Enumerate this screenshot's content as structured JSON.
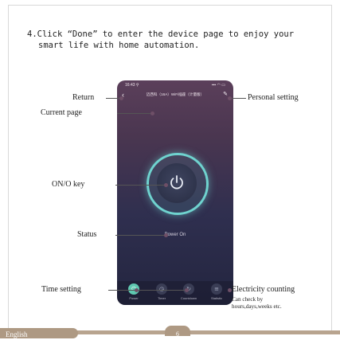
{
  "step": {
    "number": "4.",
    "text_line1": "Click “Done” to enter the device page to enjoy your",
    "text_line2": "smart life with home automation."
  },
  "phone": {
    "status_time": "16:43 ⚲",
    "status_icons": "▪▪▪ ◠ ▭",
    "title": "迈西科（16A）WiFi插座（计量版）",
    "power_state": "Power On",
    "bottom_items": [
      {
        "label": "Power",
        "icon": "power-icon",
        "active": true
      },
      {
        "label": "Timer",
        "icon": "timer-icon",
        "active": false
      },
      {
        "label": "Countdown",
        "icon": "countdown-icon",
        "active": false
      },
      {
        "label": "Statistic",
        "icon": "statistic-icon",
        "active": false
      }
    ]
  },
  "annotations": {
    "return": "Return",
    "current_page": "Current page",
    "personal_setting": "Personal setting",
    "on_off_key": "ON/O    key",
    "status": "Status",
    "time_setting": "Time setting",
    "electricity_counting": "Electricity counting",
    "electricity_note_1": "Can check by",
    "electricity_note_2": "hours,days,weeks etc."
  },
  "footer": {
    "language": "English",
    "page_number": "6"
  },
  "colors": {
    "accent_teal": "#6fd3cf",
    "footer_brown": "#ae9983",
    "marker": "#6e4f67"
  }
}
